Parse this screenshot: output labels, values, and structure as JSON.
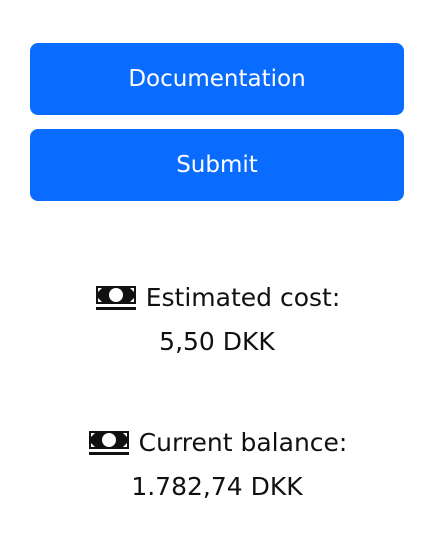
{
  "buttons": {
    "documentation_label": "Documentation",
    "submit_label": "Submit"
  },
  "estimated_cost": {
    "icon": "money-icon",
    "label": "Estimated cost:",
    "value": "5,50 DKK"
  },
  "current_balance": {
    "icon": "money-icon",
    "label": "Current balance:",
    "value": "1.782,74 DKK"
  },
  "colors": {
    "button_bg": "#0a6cff",
    "button_text": "#ffffff",
    "text": "#111111"
  }
}
